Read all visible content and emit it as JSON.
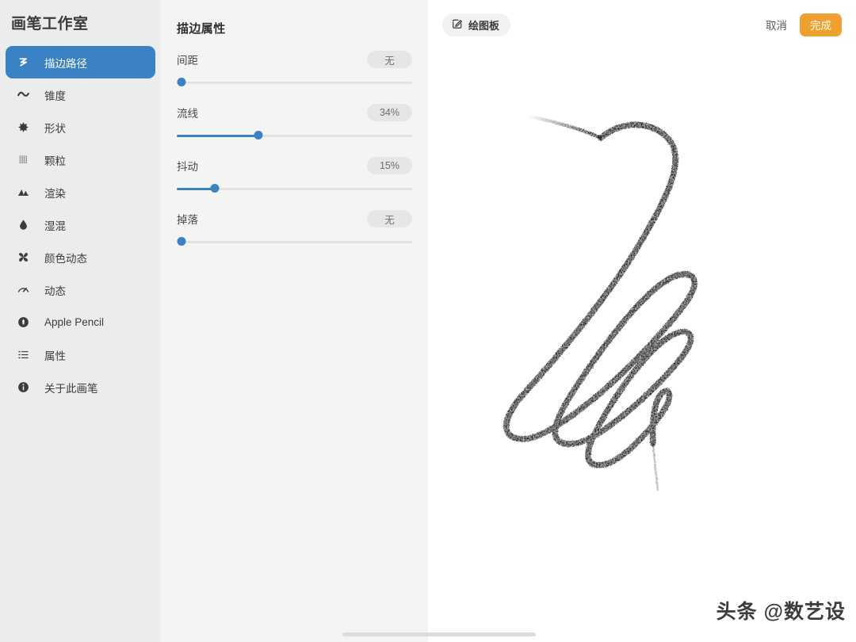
{
  "app": {
    "title": "画笔工作室"
  },
  "sidebar": {
    "items": [
      {
        "label": "描边路径",
        "icon": "stroke-path-icon",
        "active": true
      },
      {
        "label": "锥度",
        "icon": "taper-wave-icon",
        "active": false
      },
      {
        "label": "形状",
        "icon": "shape-starburst-icon",
        "active": false
      },
      {
        "label": "颗粒",
        "icon": "grain-grid-icon",
        "active": false
      },
      {
        "label": "渲染",
        "icon": "render-mountain-icon",
        "active": false
      },
      {
        "label": "湿混",
        "icon": "wet-mix-droplet-icon",
        "active": false
      },
      {
        "label": "颜色动态",
        "icon": "color-dynamics-pinwheel-icon",
        "active": false
      },
      {
        "label": "动态",
        "icon": "dynamics-gauge-icon",
        "active": false
      },
      {
        "label": "Apple Pencil",
        "icon": "apple-pencil-icon",
        "active": false
      },
      {
        "label": "属性",
        "icon": "properties-list-icon",
        "active": false
      },
      {
        "label": "关于此画笔",
        "icon": "info-circle-icon",
        "active": false
      }
    ]
  },
  "settings": {
    "title": "描边属性",
    "sliders": [
      {
        "label": "间距",
        "value": "无",
        "percent": 0
      },
      {
        "label": "流线",
        "value": "34%",
        "percent": 34
      },
      {
        "label": "抖动",
        "value": "15%",
        "percent": 15
      },
      {
        "label": "掉落",
        "value": "无",
        "percent": 0
      }
    ]
  },
  "toolbar": {
    "drawpad_label": "绘图板",
    "drawpad_icon": "edit-square-pencil-icon",
    "cancel_label": "取消",
    "done_label": "完成"
  },
  "canvas": {
    "watermark": "头条 @数艺设"
  },
  "colors": {
    "accent_blue": "#3b82c4",
    "done_orange": "#f0a02c",
    "sidebar_bg": "#ebecec",
    "panel_bg": "#f4f4f3",
    "canvas_bg": "#ffffff"
  }
}
